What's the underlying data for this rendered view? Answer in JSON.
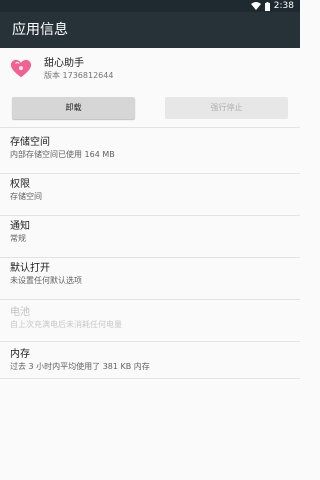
{
  "status_bar": {
    "time": "2:38"
  },
  "app_bar": {
    "title": "应用信息"
  },
  "app": {
    "name": "甜心助手",
    "version": "版本 1736812644",
    "icon": "heart-icon"
  },
  "buttons": {
    "uninstall": "卸载",
    "force_stop": "强行停止"
  },
  "settings": [
    {
      "title": "存储空间",
      "summary": "内部存储空间已使用 164 MB",
      "enabled": true
    },
    {
      "title": "权限",
      "summary": "存储空间",
      "enabled": true
    },
    {
      "title": "通知",
      "summary": "常规",
      "enabled": true
    },
    {
      "title": "默认打开",
      "summary": "未设置任何默认选项",
      "enabled": true
    },
    {
      "title": "电池",
      "summary": "自上次充满电后未消耗任何电量",
      "enabled": false
    },
    {
      "title": "内存",
      "summary": "过去 3 小时内平均使用了 381 KB 内存",
      "enabled": true
    }
  ],
  "colors": {
    "app_bar": "#263238",
    "status_bar": "#1f2a30",
    "background": "#fafafa",
    "icon_pink": "#f06292"
  }
}
